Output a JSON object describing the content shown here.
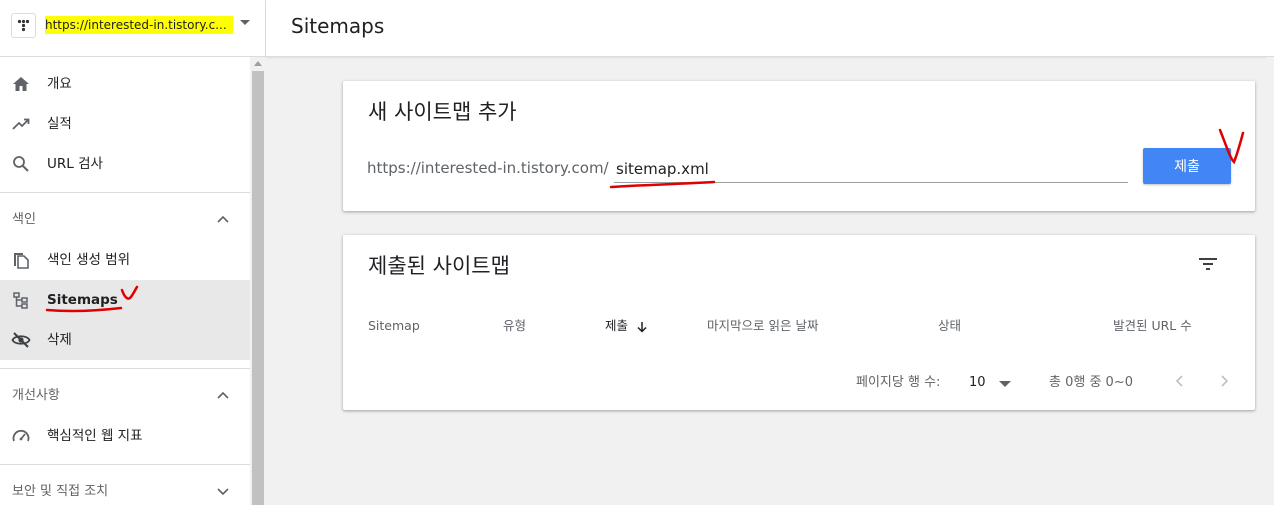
{
  "property": {
    "url": "https://interested-in.tistory.c..."
  },
  "sidebar": {
    "top_items": [
      {
        "label": "개요",
        "icon": "home-icon"
      },
      {
        "label": "실적",
        "icon": "trending-up-icon"
      },
      {
        "label": "URL 검사",
        "icon": "search-icon"
      }
    ],
    "sections": [
      {
        "title": "색인",
        "items": [
          {
            "label": "색인 생성 범위",
            "icon": "copy-icon"
          },
          {
            "label": "Sitemaps",
            "icon": "sitemap-icon"
          },
          {
            "label": "삭제",
            "icon": "visibility-off-icon"
          }
        ]
      },
      {
        "title": "개선사항",
        "items": [
          {
            "label": "핵심적인 웹 지표",
            "icon": "speedometer-icon"
          }
        ]
      },
      {
        "title": "보안 및 직접 조치",
        "items": []
      }
    ]
  },
  "header": {
    "title": "Sitemaps"
  },
  "add_sitemap": {
    "title": "새 사이트맵 추가",
    "url_prefix": "https://interested-in.tistory.com/",
    "input_value": "sitemap.xml",
    "submit_label": "제출"
  },
  "submitted": {
    "title": "제출된 사이트맵",
    "columns": [
      "Sitemap",
      "유형",
      "제출",
      "마지막으로 읽은 날짜",
      "상태",
      "발견된 URL 수"
    ],
    "pager": {
      "rows_label": "페이지당 행 수:",
      "rows_value": "10",
      "range_text": "총 0행 중 0~0"
    }
  },
  "colors": {
    "accent": "#4285f4",
    "highlight": "#ffff00",
    "annotation": "#e00000"
  }
}
